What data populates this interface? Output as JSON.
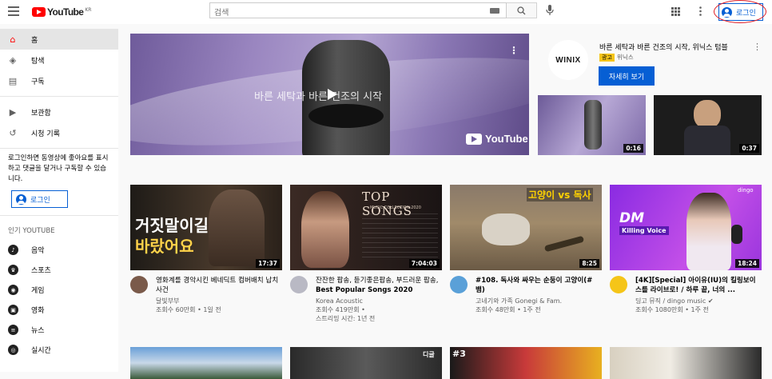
{
  "header": {
    "logo_text": "YouTube",
    "logo_region": "KR",
    "search_placeholder": "검색",
    "signin_label": "로그인"
  },
  "sidebar": {
    "primary": [
      {
        "label": "홈",
        "icon": "home-icon",
        "active": true
      },
      {
        "label": "탐색",
        "icon": "compass-icon"
      },
      {
        "label": "구독",
        "icon": "subscriptions-icon"
      }
    ],
    "secondary": [
      {
        "label": "보관함",
        "icon": "library-icon"
      },
      {
        "label": "시청 기록",
        "icon": "history-icon"
      }
    ],
    "signin_note": "로그인하면 동영상에 좋아요를 표시하고 댓글을 달거나 구독할 수 있습니다.",
    "signin_button": "로그인",
    "popular_heading": "인기 YOUTUBE",
    "categories": [
      {
        "label": "음악",
        "icon": "music-icon"
      },
      {
        "label": "스포츠",
        "icon": "trophy-icon"
      },
      {
        "label": "게임",
        "icon": "gamepad-icon"
      },
      {
        "label": "영화",
        "icon": "film-icon"
      },
      {
        "label": "뉴스",
        "icon": "news-icon"
      },
      {
        "label": "실시간",
        "icon": "live-icon"
      }
    ]
  },
  "ad": {
    "banner_caption": "바른 세탁과 바른 건조의 시작",
    "banner_brand": "YouTube",
    "advertiser_logo": "WINIX",
    "title": "바른 세탁과 바른 건조의 시작, 위닉스 텀블",
    "badge": "광고",
    "advertiser": "위닉스",
    "cta": "자세히 보기",
    "thumbs": [
      {
        "duration": "0:16",
        "color": "#8a77b4"
      },
      {
        "duration": "0:37",
        "color": "#1c1c1c"
      }
    ]
  },
  "videos": [
    {
      "title": "영화계를 경악시킨 베네딕트 컴버배치 납치 사건",
      "channel": "달빛부부",
      "meta": [
        "조회수 60만회 • 1일 전"
      ],
      "duration": "17:37",
      "thumb_text": [
        "거짓말이길",
        "바랐어요"
      ],
      "avatar_color": "#7a5a4a"
    },
    {
      "title_plain": "잔잔한 팝송, 듣기좋은팝송, 부드러운 팝송, ",
      "title_bold": "Best Popular Songs 2020",
      "channel": "Korea Acoustic",
      "meta": [
        "조회수 419만회 •",
        "스트리밍 시간: 1년 전"
      ],
      "duration": "7:04:03",
      "thumb_text": [
        "TOP SONGS",
        "MUSIC COLLECTION 2020"
      ],
      "avatar_color": "#b9b9c4"
    },
    {
      "title": "#108. 독사와 싸우는 순둥이 고양이(# 뱀)",
      "channel": "고네기와 가족 Gonegi & Fam.",
      "meta": [
        "조회수 48만회 • 1주 전"
      ],
      "duration": "8:25",
      "thumb_text": [
        "고양이 vs 독사"
      ],
      "avatar_color": "#5aa0d8"
    },
    {
      "title": "[4K][Special] 아이유(IU)의 킬링보이스를 라이브로! / 하루 끝, 너의 ...",
      "channel": "딩고 뮤직 / dingo music ✔",
      "meta": [
        "조회수 1080만회 • 1주 전"
      ],
      "duration": "18:24",
      "thumb_text": [
        "DM",
        "Killing Voice",
        "dingo"
      ],
      "avatar_color": "#f5c518"
    }
  ],
  "row2": [
    {
      "thumb_text": ""
    },
    {
      "thumb_text": "디글"
    },
    {
      "thumb_text": "#3"
    },
    {
      "thumb_text": ""
    }
  ]
}
